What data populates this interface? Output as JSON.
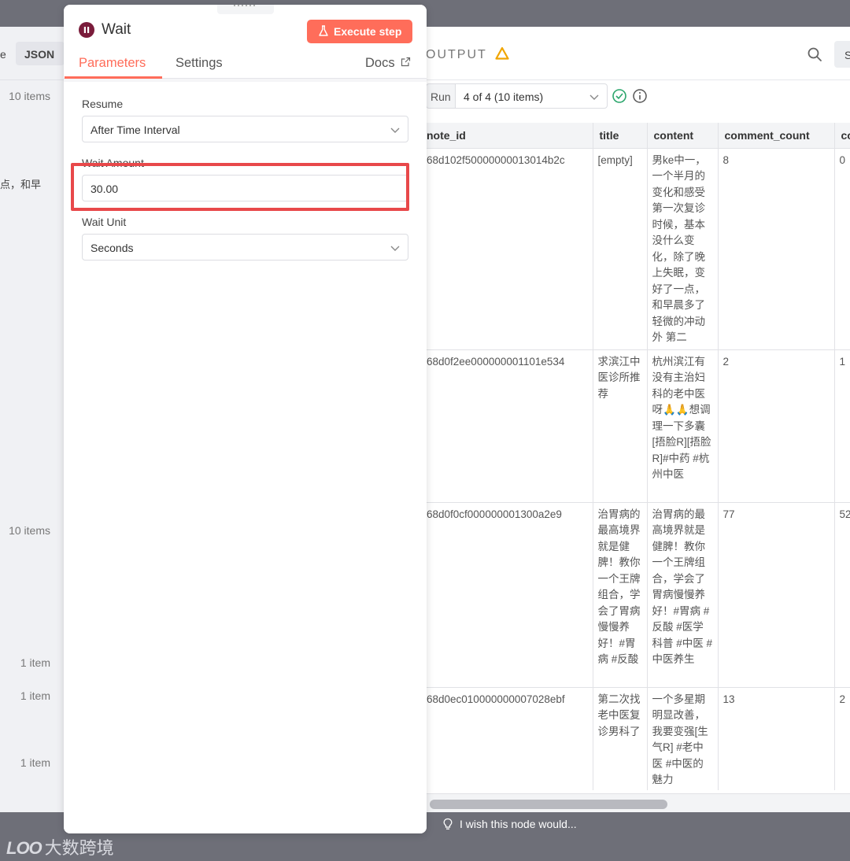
{
  "input_panel": {
    "tab_partial": "e",
    "json_tab": "JSON",
    "counts": [
      "10 items",
      "10 items",
      "1 item",
      "1 item",
      "1 item"
    ],
    "snippet": "点，和早"
  },
  "node": {
    "title": "Wait",
    "execute_label": "Execute step",
    "tabs": {
      "parameters": "Parameters",
      "settings": "Settings"
    },
    "docs_label": "Docs",
    "fields": {
      "resume": {
        "label": "Resume",
        "value": "After Time Interval"
      },
      "wait_amount": {
        "label": "Wait Amount",
        "value": "30.00"
      },
      "wait_unit": {
        "label": "Wait Unit",
        "value": "Seconds"
      }
    }
  },
  "output": {
    "title": "OUTPUT",
    "run_label": "Run",
    "run_value": "4 of 4 (10 items)",
    "side_button": "S",
    "columns": [
      "note_id",
      "title",
      "content",
      "comment_count",
      "co"
    ],
    "rows": [
      {
        "note_id": "68d102f50000000013014b2c",
        "title": "[empty]",
        "content": "男ke中一，一个半月的变化和感受 第一次复诊时候，基本没什么变化，除了晚上失眠，变好了一点，和早晨多了轻微的冲动 外 第二",
        "comment_count": "8",
        "co": "0"
      },
      {
        "note_id": "68d0f2ee000000001101e534",
        "title": "求滨江中医诊所推荐",
        "content": "杭州滨江有没有主治妇科的老中医呀🙏🙏想调理一下多囊[捂脸R][捂脸R]#中药 #杭州中医",
        "comment_count": "2",
        "co": "1"
      },
      {
        "note_id": "68d0f0cf000000001300a2e9",
        "title": "治胃病的最高境界就是健脾！教你一个王牌组合，学会了胃病慢慢养好！#胃病 #反酸",
        "content": "治胃病的最高境界就是健脾！教你一个王牌组合，学会了胃病慢慢养好！#胃病 #反酸 #医学科普 #中医 #中医养生",
        "comment_count": "77",
        "co": "52"
      },
      {
        "note_id": "68d0ec010000000007028ebf",
        "title": "第二次找老中医复诊男科了",
        "content": "一个多星期明显改善，我要变强[生气R] #老中医 #中医的魅力",
        "comment_count": "13",
        "co": "2"
      }
    ]
  },
  "feedback": {
    "text": "I wish this node would..."
  },
  "watermark": {
    "logo": "LOO",
    "text": "大数跨境"
  },
  "colors": {
    "accent": "#ff6d5a",
    "highlight": "#e8484a",
    "warning": "#f0a500",
    "success": "#2aa56b"
  }
}
